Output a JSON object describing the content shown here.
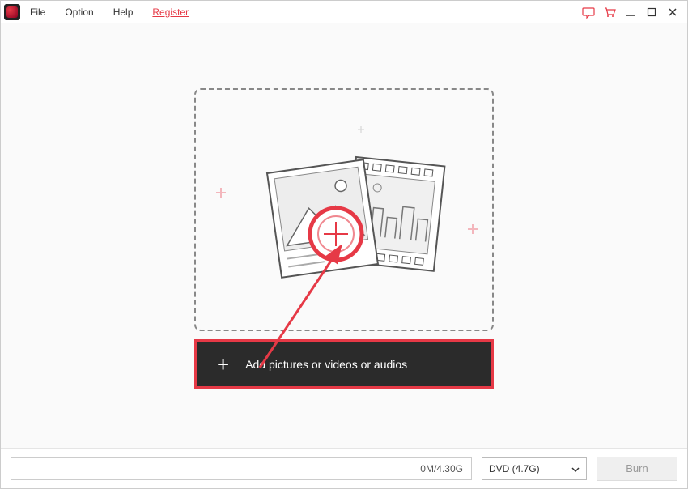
{
  "menu": {
    "file": "File",
    "option": "Option",
    "help": "Help",
    "register": "Register"
  },
  "dropzone": {
    "add_label": "Add pictures or videos or audios"
  },
  "bottombar": {
    "progress": "0M/4.30G",
    "disc_option": "DVD (4.7G)",
    "burn_label": "Burn"
  },
  "colors": {
    "accent": "#e63946"
  }
}
